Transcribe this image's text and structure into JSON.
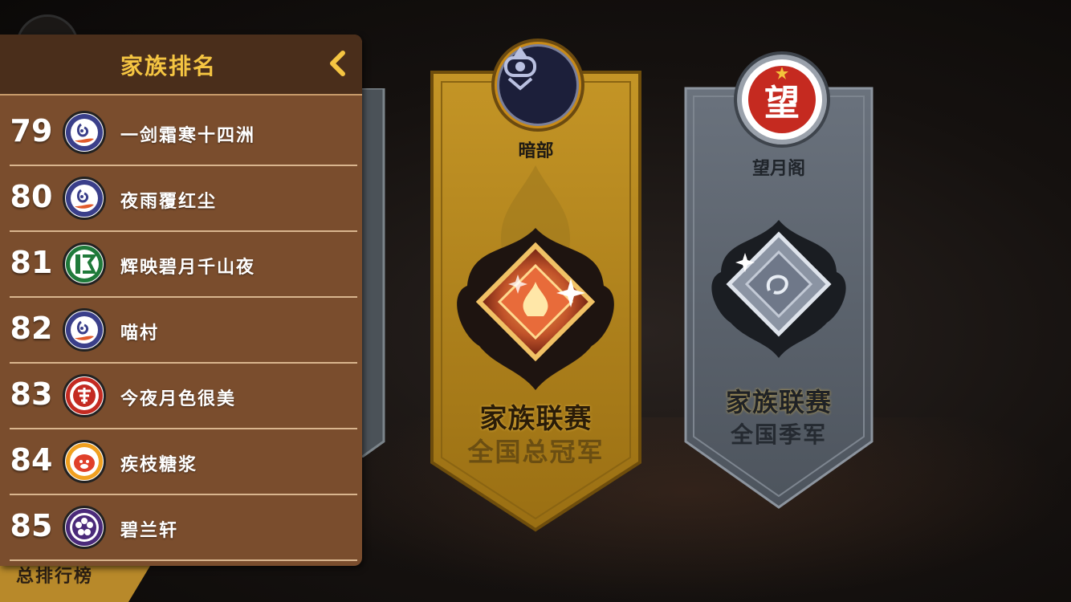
{
  "panel": {
    "title": "家族排名",
    "back_icon": "chevron-left-icon"
  },
  "ranking": [
    {
      "rank": "79",
      "name": "一剑霜寒十四洲",
      "badge": "purple-dragon"
    },
    {
      "rank": "80",
      "name": "夜雨覆红尘",
      "badge": "purple-dragon"
    },
    {
      "rank": "81",
      "name": "辉映碧月千山夜",
      "badge": "green-seal"
    },
    {
      "rank": "82",
      "name": "喵村",
      "badge": "purple-dragon"
    },
    {
      "rank": "83",
      "name": "今夜月色很美",
      "badge": "red-seal"
    },
    {
      "rank": "84",
      "name": "疾枝糖浆",
      "badge": "orange-pig"
    },
    {
      "rank": "85",
      "name": "碧兰轩",
      "badge": "purple-flower"
    }
  ],
  "banners": [
    {
      "name": "暗部",
      "title": "家族联赛",
      "subtitle": "全国总冠军",
      "theme": "gold"
    },
    {
      "name": "望月阁",
      "title": "家族联赛",
      "subtitle": "全国季军",
      "theme": "silver"
    }
  ],
  "bottom_tab": {
    "label": "总排行榜"
  },
  "colors": {
    "panel_bg": "#7a4d2d",
    "header_bg": "#4a2e1b",
    "title_gold": "#f5c542",
    "gold_banner": "#b88a1e",
    "silver_banner": "#5f6773"
  }
}
